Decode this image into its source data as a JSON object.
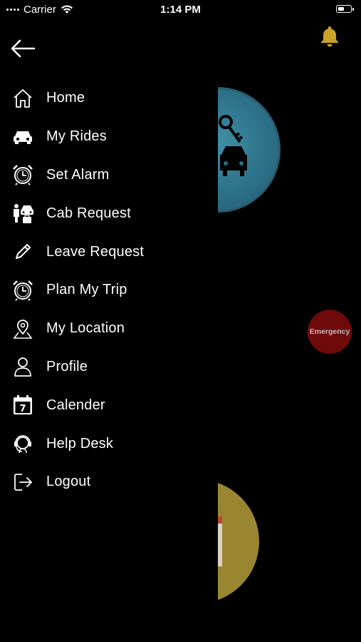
{
  "status_bar": {
    "carrier": "Carrier",
    "time": "1:14 PM"
  },
  "menu": [
    {
      "label": "Home",
      "icon": "home-icon"
    },
    {
      "label": "My Rides",
      "icon": "car-icon"
    },
    {
      "label": "Set Alarm",
      "icon": "alarm-clock-icon"
    },
    {
      "label": "Cab Request",
      "icon": "cab-request-icon"
    },
    {
      "label": "Leave Request",
      "icon": "pencil-icon"
    },
    {
      "label": "Plan My Trip",
      "icon": "alarm-clock-icon"
    },
    {
      "label": "My Location",
      "icon": "location-pin-icon"
    },
    {
      "label": "Profile",
      "icon": "user-icon"
    },
    {
      "label": "Calender",
      "icon": "calendar-icon",
      "badge": "7"
    },
    {
      "label": "Help Desk",
      "icon": "headset-icon"
    },
    {
      "label": "Logout",
      "icon": "logout-icon"
    }
  ],
  "emergency_button": {
    "label": "Emergency"
  },
  "colors": {
    "background": "#000000",
    "bell": "#c9a227",
    "teal_circle": "#2c6f86",
    "gold_circle": "#9a8530",
    "emergency": "#6e0a0a"
  }
}
